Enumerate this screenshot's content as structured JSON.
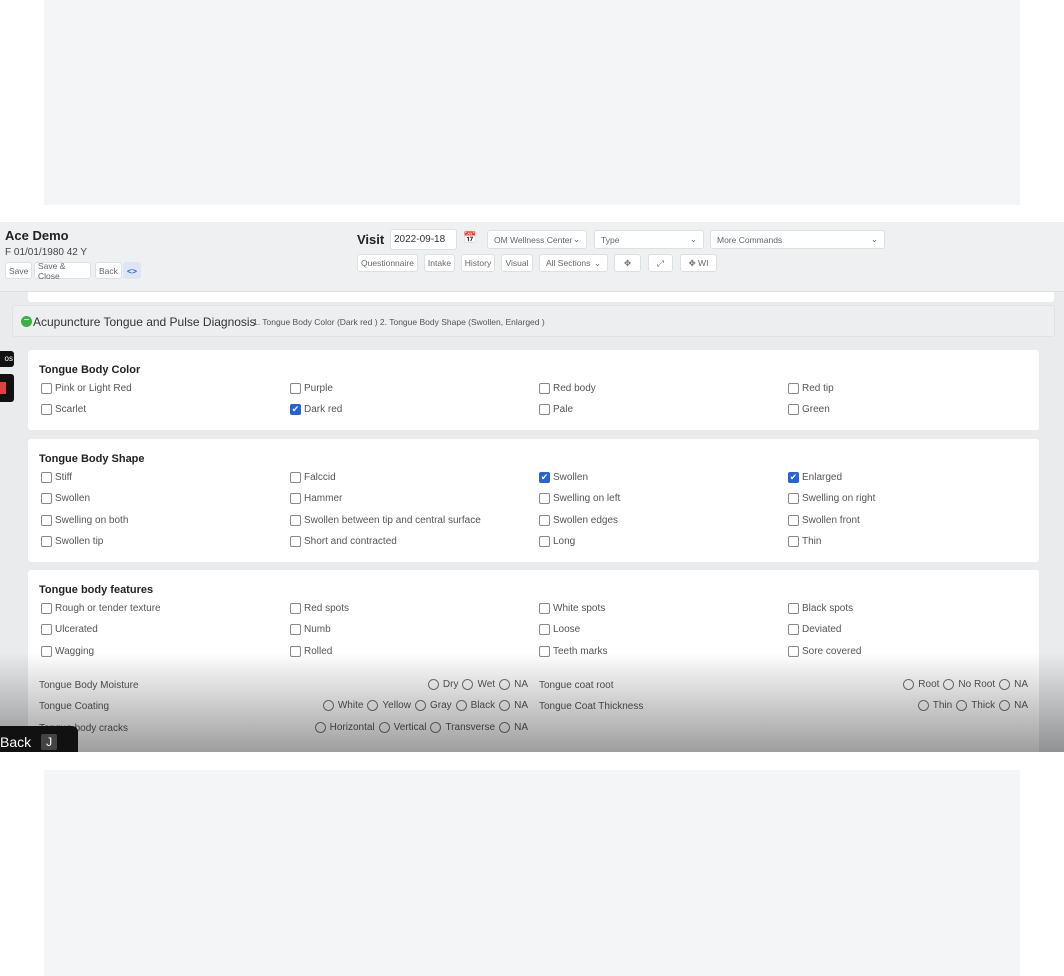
{
  "patient": {
    "name": "Ace Demo",
    "info": "F 01/01/1980 42 Y"
  },
  "actions": {
    "save": "Save",
    "save_close": "Save & Close",
    "back": "Back",
    "code_icon": "code-arrows-icon"
  },
  "visit": {
    "label": "Visit",
    "date": "2022-09-18",
    "calendar_icon": "calendar-icon",
    "location": "OM Wellness Center",
    "type": "Type",
    "more": "More Commands"
  },
  "nav": {
    "questionnaire": "Questionnaire",
    "intake": "Intake",
    "history": "History",
    "visual": "Visual",
    "sections": "All Sections",
    "wi": "WI"
  },
  "section": {
    "title": "Acupuncture Tongue and Pulse Diagnosis",
    "summary": "1. Tongue Body Color (Dark red ) 2. Tongue Body Shape (Swollen, Enlarged )",
    "status_color": "#3cb043"
  },
  "groups": [
    {
      "title": "Tongue Body Color",
      "items": [
        {
          "label": "Pink or Light Red",
          "checked": false
        },
        {
          "label": "Purple",
          "checked": false
        },
        {
          "label": "Red body",
          "checked": false
        },
        {
          "label": "Red tip",
          "checked": false
        },
        {
          "label": "Scarlet",
          "checked": false
        },
        {
          "label": "Dark red",
          "checked": true
        },
        {
          "label": "Pale",
          "checked": false
        },
        {
          "label": "Green",
          "checked": false
        }
      ]
    },
    {
      "title": "Tongue Body Shape",
      "items": [
        {
          "label": "Stiff",
          "checked": false
        },
        {
          "label": "Falccid",
          "checked": false
        },
        {
          "label": "Swollen",
          "checked": true
        },
        {
          "label": "Enlarged",
          "checked": true
        },
        {
          "label": "Swollen",
          "checked": false
        },
        {
          "label": "Hammer",
          "checked": false
        },
        {
          "label": "Swelling on left",
          "checked": false
        },
        {
          "label": "Swelling on right",
          "checked": false
        },
        {
          "label": "Swelling on both",
          "checked": false
        },
        {
          "label": "Swollen between tip and central surface",
          "checked": false
        },
        {
          "label": "Swollen edges",
          "checked": false
        },
        {
          "label": "Swollen front",
          "checked": false
        },
        {
          "label": "Swollen tip",
          "checked": false
        },
        {
          "label": "Short and contracted",
          "checked": false
        },
        {
          "label": "Long",
          "checked": false
        },
        {
          "label": "Thin",
          "checked": false
        }
      ]
    },
    {
      "title": "Tongue body features",
      "items": [
        {
          "label": "Rough or tender texture",
          "checked": false
        },
        {
          "label": "Red spots",
          "checked": false
        },
        {
          "label": "White spots",
          "checked": false
        },
        {
          "label": "Black spots",
          "checked": false
        },
        {
          "label": "Ulcerated",
          "checked": false
        },
        {
          "label": "Numb",
          "checked": false
        },
        {
          "label": "Loose",
          "checked": false
        },
        {
          "label": "Deviated",
          "checked": false
        },
        {
          "label": "Wagging",
          "checked": false
        },
        {
          "label": "Rolled",
          "checked": false
        },
        {
          "label": "Teeth marks",
          "checked": false
        },
        {
          "label": "Sore covered",
          "checked": false
        }
      ]
    }
  ],
  "radios": [
    {
      "label": "Tongue Body Moisture",
      "options": [
        "Dry",
        "Wet",
        "NA"
      ],
      "col": 0
    },
    {
      "label": "Tongue coat root",
      "options": [
        "Root",
        "No Root",
        "NA"
      ],
      "col": 1
    },
    {
      "label": "Tongue Coating",
      "options": [
        "White",
        "Yellow",
        "Gray",
        "Black",
        "NA"
      ],
      "col": 0
    },
    {
      "label": "Tongue Coat Thickness",
      "options": [
        "Thin",
        "Thick",
        "NA"
      ],
      "col": 1
    },
    {
      "label": "Tongue body cracks",
      "options": [
        "Horizontal",
        "Vertical",
        "Transverse",
        "NA"
      ],
      "col": 0
    }
  ],
  "overlay": {
    "side_tag": "os",
    "back": "Back",
    "key": "J"
  },
  "accent": "#2563d8"
}
